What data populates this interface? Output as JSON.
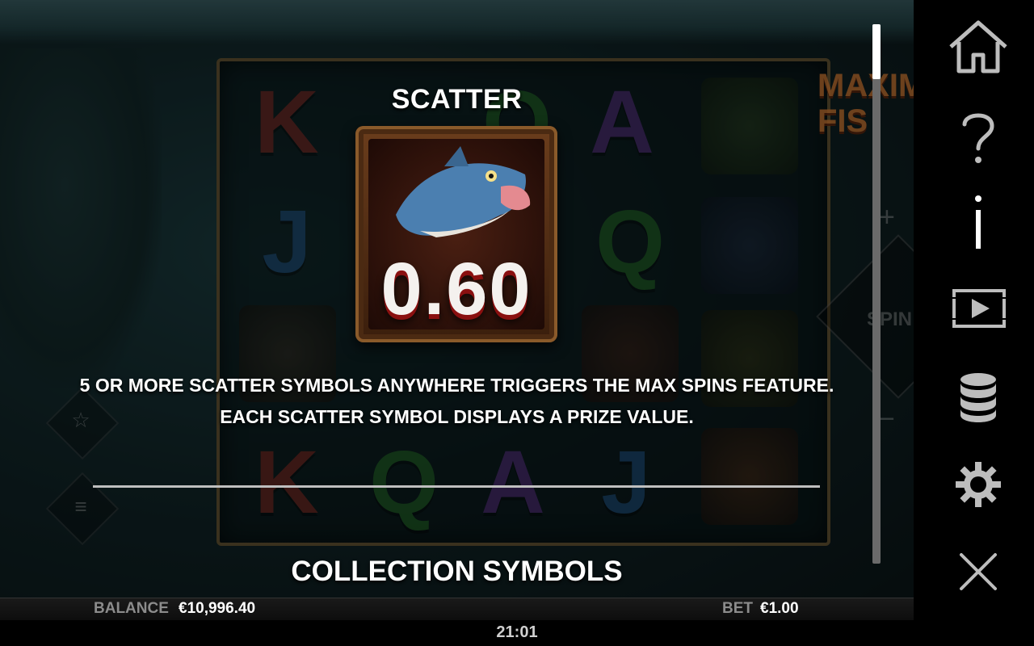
{
  "game": {
    "logo_text": "MAXIM FIS",
    "spin_label": "SPIN",
    "plus_symbol": "+",
    "minus_symbol": "−",
    "reel_letters": {
      "k": "K",
      "q": "Q",
      "a": "A",
      "j": "J"
    }
  },
  "info": {
    "title": "SCATTER",
    "scatter_value": "0.60",
    "rule_line_1": "5 OR MORE SCATTER SYMBOLS ANYWHERE TRIGGERS THE MAX SPINS FEATURE.",
    "rule_line_2": "EACH SCATTER SYMBOL DISPLAYS A PRIZE VALUE.",
    "next_section_title": "COLLECTION SYMBOLS"
  },
  "bottom_bar": {
    "balance_label": "BALANCE",
    "balance_value": "€10,996.40",
    "bet_label": "BET",
    "bet_value": "€1.00"
  },
  "status": {
    "time": "21:01"
  },
  "sidebar": {
    "items": [
      {
        "icon": "home-icon"
      },
      {
        "icon": "help-icon"
      },
      {
        "icon": "info-icon",
        "active": true
      },
      {
        "icon": "autoplay-icon"
      },
      {
        "icon": "coins-icon"
      },
      {
        "icon": "settings-icon"
      },
      {
        "icon": "close-icon"
      }
    ]
  },
  "colors": {
    "accent_white": "#ffffff",
    "label_grey": "#8c8c8c",
    "scatter_red": "#8a1010"
  }
}
